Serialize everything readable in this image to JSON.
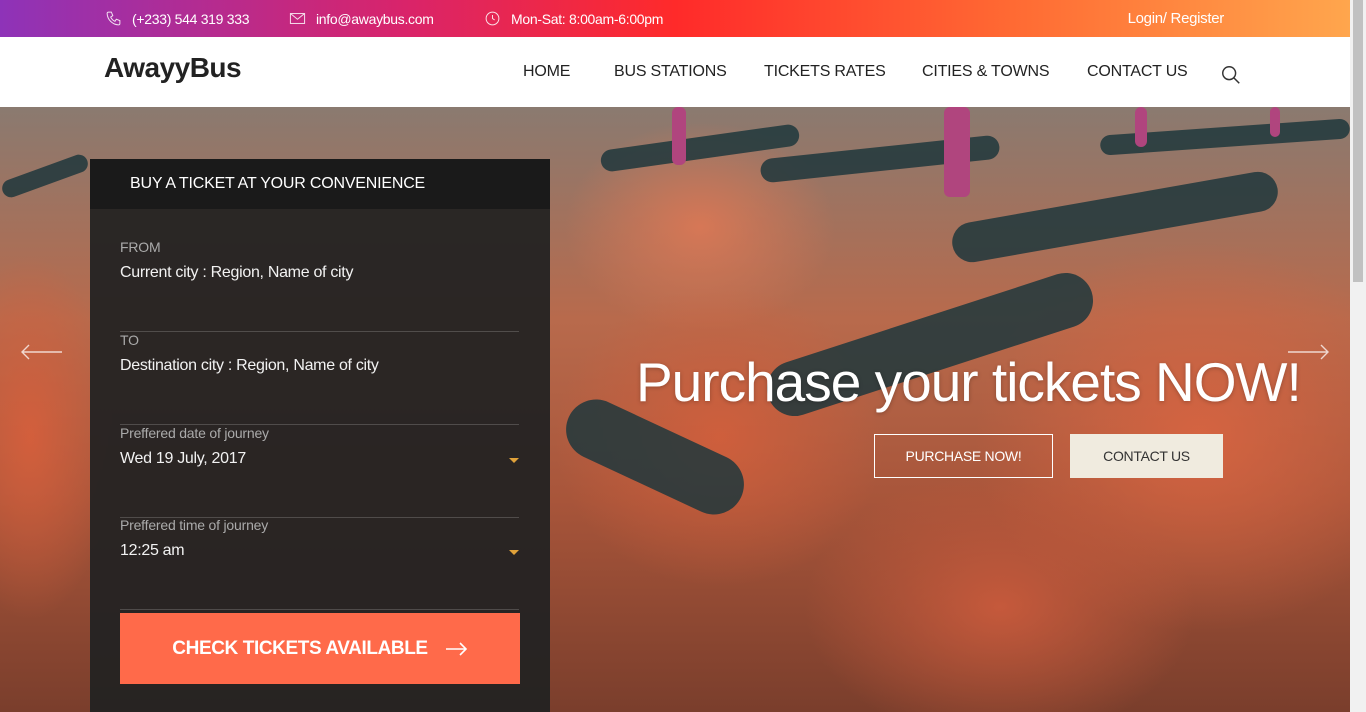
{
  "topbar": {
    "phone": "(+233) 544 319 333",
    "email": "info@awaybus.com",
    "hours": "Mon-Sat: 8:00am-6:00pm",
    "login": "Login/ Register"
  },
  "header": {
    "logo": "AwayyBus",
    "nav": [
      {
        "label": "HOME"
      },
      {
        "label": "BUS STATIONS"
      },
      {
        "label": "TICKETS RATES"
      },
      {
        "label": "CITIES & TOWNS"
      },
      {
        "label": "CONTACT US"
      }
    ]
  },
  "booking": {
    "title": "BUY A TICKET AT YOUR CONVENIENCE",
    "fields": [
      {
        "label": "FROM",
        "value": "Current city : Region, Name of city"
      },
      {
        "label": "TO",
        "value": "Destination city : Region, Name of city"
      },
      {
        "label": "Preffered date of journey",
        "value": "Wed 19 July, 2017"
      },
      {
        "label": "Preffered time of journey",
        "value": "12:25 am"
      }
    ],
    "submit": "CHECK TICKETS AVAILABLE"
  },
  "hero": {
    "headline": "Purchase your tickets NOW!",
    "primary_button": "PURCHASE NOW!",
    "secondary_button": "CONTACT US"
  },
  "colors": {
    "accent": "#ff6a4a",
    "caret": "#e0a23a",
    "panel": "#222222"
  }
}
